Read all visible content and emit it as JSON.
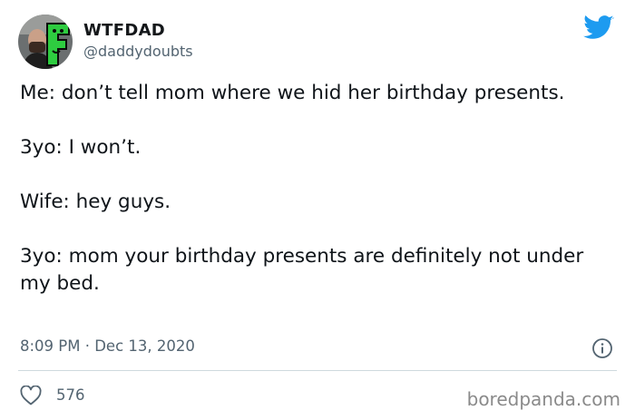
{
  "tweet": {
    "display_name": "WTFDAD",
    "handle": "@daddydoubts",
    "body": [
      "Me: don’t tell mom where we hid her birthday presents.",
      "3yo: I won’t.",
      "Wife: hey guys.",
      "3yo: mom your birthday presents are definitely not under my bed."
    ],
    "timestamp": "8:09 PM · Dec 13, 2020",
    "likes": "576"
  },
  "watermark": "boredpanda.com",
  "icons": {
    "brand": "twitter-bird-icon",
    "info": "info-icon",
    "like": "heart-icon",
    "avatar_badge": "letter-f-logo"
  },
  "colors": {
    "twitter_blue": "#1d9bf0",
    "secondary_text": "#536471",
    "avatar_green": "#2ecc40",
    "divider": "#cfd9de"
  }
}
